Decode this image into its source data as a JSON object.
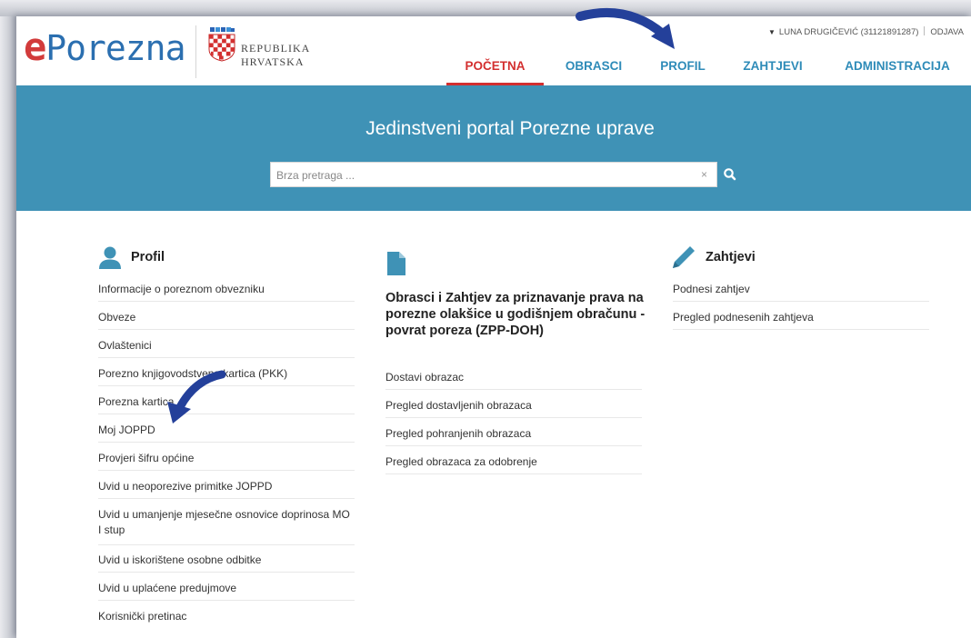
{
  "header": {
    "logo_e": "e",
    "logo_rest": "Porezna",
    "republic_line1": "REPUBLIKA",
    "republic_line2": "HRVATSKA",
    "user": "LUNA DRUGIČEVIĆ (31121891287)",
    "logout": "ODJAVA"
  },
  "nav": [
    {
      "label": "POČETNA",
      "active": true
    },
    {
      "label": "OBRASCI",
      "active": false
    },
    {
      "label": "PROFIL",
      "active": false
    },
    {
      "label": "ZAHTJEVI",
      "active": false
    },
    {
      "label": "ADMINISTRACIJA",
      "active": false
    }
  ],
  "hero": {
    "title": "Jedinstveni portal Porezne uprave",
    "search_placeholder": "Brza pretraga ...",
    "clear_symbol": "×"
  },
  "profil": {
    "title": "Profil",
    "items": [
      "Informacije o poreznom obvezniku",
      "Obveze",
      "Ovlaštenici",
      "Porezno knjigovodstvena kartica (PKK)",
      "Porezna kartica",
      "Moj JOPPD",
      "Provjeri šifru općine",
      "Uvid u neoporezive primitke JOPPD",
      "Uvid u umanjenje mjesečne osnovice doprinosa MO I stup",
      "Uvid u iskorištene osobne odbitke",
      "Uvid u uplaćene predujmove",
      "Korisnički pretinac"
    ]
  },
  "obrasci": {
    "title": "Obrasci i Zahtjev za priznavanje prava na porezne olakšice u godišnjem obračunu - povrat poreza (ZPP-DOH)",
    "items": [
      "Dostavi obrazac",
      "Pregled dostavljenih obrazaca",
      "Pregled pohranjenih obrazaca",
      "Pregled obrazaca za odobrenje"
    ]
  },
  "zahtjevi": {
    "title": "Zahtjevi",
    "items": [
      "Podnesi zahtjev",
      "Pregled podnesenih zahtjeva"
    ]
  },
  "colors": {
    "accent_blue": "#3f92b6",
    "nav_blue": "#2e8bb8",
    "active_red": "#d32f2f",
    "arrow_navy": "#24409a"
  }
}
